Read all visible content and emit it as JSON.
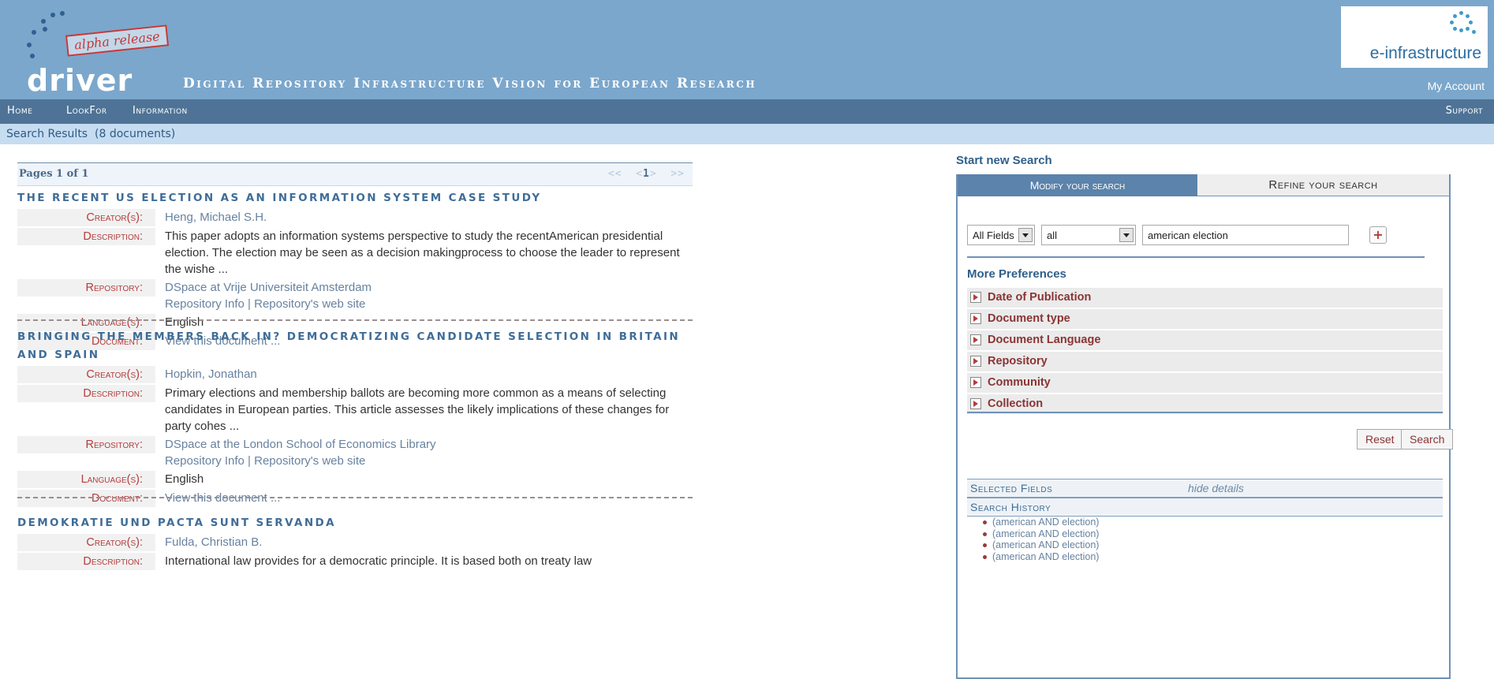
{
  "header": {
    "logo_stamp": "alpha release",
    "logo_word": "driver",
    "tagline": "Digital Repository Infrastructure Vision for European Research",
    "partner_logo": "e-infrastructure",
    "my_account": "My Account"
  },
  "nav": {
    "home": "Home",
    "lookfor": "LookFor",
    "information": "Information",
    "support": "Support"
  },
  "breadcrumb": "Search Results  (8 documents)",
  "pager": {
    "info": "Pages 1 of 1",
    "first": "<<",
    "prev": "<",
    "current": "1",
    "next": ">",
    "last": ">>"
  },
  "labels": {
    "creator": "Creator(s):",
    "description": "Description:",
    "repository": "Repository:",
    "language": "Language(s):",
    "document": "Document:"
  },
  "results": [
    {
      "title": "The recent US election as an information system case study",
      "creator": "Heng, Michael S.H.",
      "description": "This paper adopts an information systems perspective to study the recentAmerican presidential election. The election may be seen as a decision makingprocess to choose the leader to represent the wishe ...",
      "repository": "DSpace at Vrije Universiteit Amsterdam",
      "repo_links": "Repository Info | Repository's web site",
      "language": "English",
      "document": "View this document ..."
    },
    {
      "title": "Bringing the members back in? Democratizing candidate selection in Britain and Spain",
      "creator": "Hopkin, Jonathan",
      "description": "Primary elections and membership ballots are becoming more common as a means of selecting candidates in European parties. This article assesses the likely implications of these changes for party cohes ...",
      "repository": "DSpace at the London School of Economics Library",
      "repo_links": "Repository Info | Repository's web site",
      "language": "English",
      "document": "View this document ..."
    },
    {
      "title": "Demokratie und pacta sunt servanda",
      "creator": "Fulda, Christian B.",
      "description": "International law provides for a democratic principle. It is based both on treaty law"
    }
  ],
  "search_panel": {
    "start_new": "Start new Search",
    "tab_modify": "Modify your search",
    "tab_refine": "Refine your search",
    "field_select": "All Fields",
    "op_select": "all",
    "query": "american election",
    "add_button": "+",
    "more_prefs": "More Preferences",
    "prefs": [
      "Date of Publication",
      "Document type",
      "Document Language",
      "Repository",
      "Community",
      "Collection"
    ],
    "reset": "Reset",
    "search": "Search",
    "selected_fields": "Selected Fields",
    "hide_details": "hide details",
    "search_history": "Search History",
    "history": [
      "(american AND election)",
      "(american AND election)",
      "(american AND election)",
      "(american AND election)"
    ]
  },
  "colors": {
    "header_bg": "#7ba7cc",
    "nav_bg": "#4e7396",
    "label_red": "#b43c3c",
    "title_blue": "#3f6d98"
  }
}
